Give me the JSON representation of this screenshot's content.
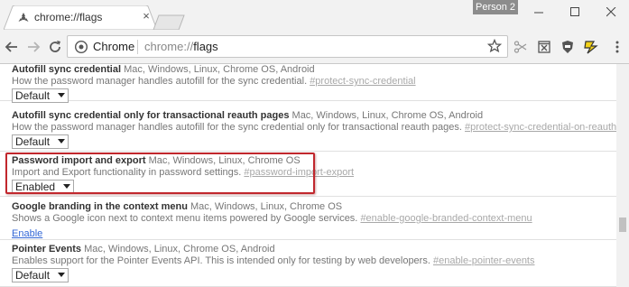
{
  "tab": {
    "title": "chrome://flags",
    "close_glyph": "×",
    "favicon_icon": "flask-icon"
  },
  "window": {
    "profile_badge": "Person 2",
    "minimize_glyph": "—",
    "maximize_glyph": "☐",
    "close_glyph": "✕"
  },
  "toolbar": {
    "back_icon": "back-arrow-icon",
    "forward_icon": "forward-arrow-icon",
    "reload_icon": "reload-icon",
    "omnibox": {
      "chip_label": "Chrome",
      "url_scheme": "chrome://",
      "url_path": "flags"
    },
    "extensions": [
      "scissors-icon",
      "reader-icon",
      "shield-icon",
      "lightning-icon"
    ]
  },
  "flags": [
    {
      "name": "Autofill sync credential",
      "platforms": "Mac, Windows, Linux, Chrome OS, Android",
      "description": "How the password manager handles autofill for the sync credential.",
      "link": "#protect-sync-credential",
      "control": "select",
      "value": "Default"
    },
    {
      "name": "Autofill sync credential only for transactional reauth pages",
      "platforms": "Mac, Windows, Linux, Chrome OS, Android",
      "description": "How the password manager handles autofill for the sync credential only for transactional reauth pages.",
      "link": "#protect-sync-credential-on-reauth",
      "control": "select",
      "value": "Default"
    },
    {
      "name": "Password import and export",
      "platforms": "Mac, Windows, Linux, Chrome OS",
      "description": "Import and Export functionality in password settings.",
      "link": "#password-import-export",
      "control": "select",
      "value": "Enabled",
      "highlighted": true
    },
    {
      "name": "Google branding in the context menu",
      "platforms": "Mac, Windows, Linux, Chrome OS",
      "description": "Shows a Google icon next to context menu items powered by Google services.",
      "link": "#enable-google-branded-context-menu",
      "control": "link",
      "value": "Enable"
    },
    {
      "name": "Pointer Events",
      "platforms": "Mac, Windows, Linux, Chrome OS, Android",
      "description": "Enables support for the Pointer Events API. This is intended only for testing by web developers.",
      "link": "#enable-pointer-events",
      "control": "select",
      "value": "Default"
    }
  ],
  "colors": {
    "highlight": "#c1272d",
    "link": "#3367d6",
    "muted_link": "#a8a8a8"
  }
}
